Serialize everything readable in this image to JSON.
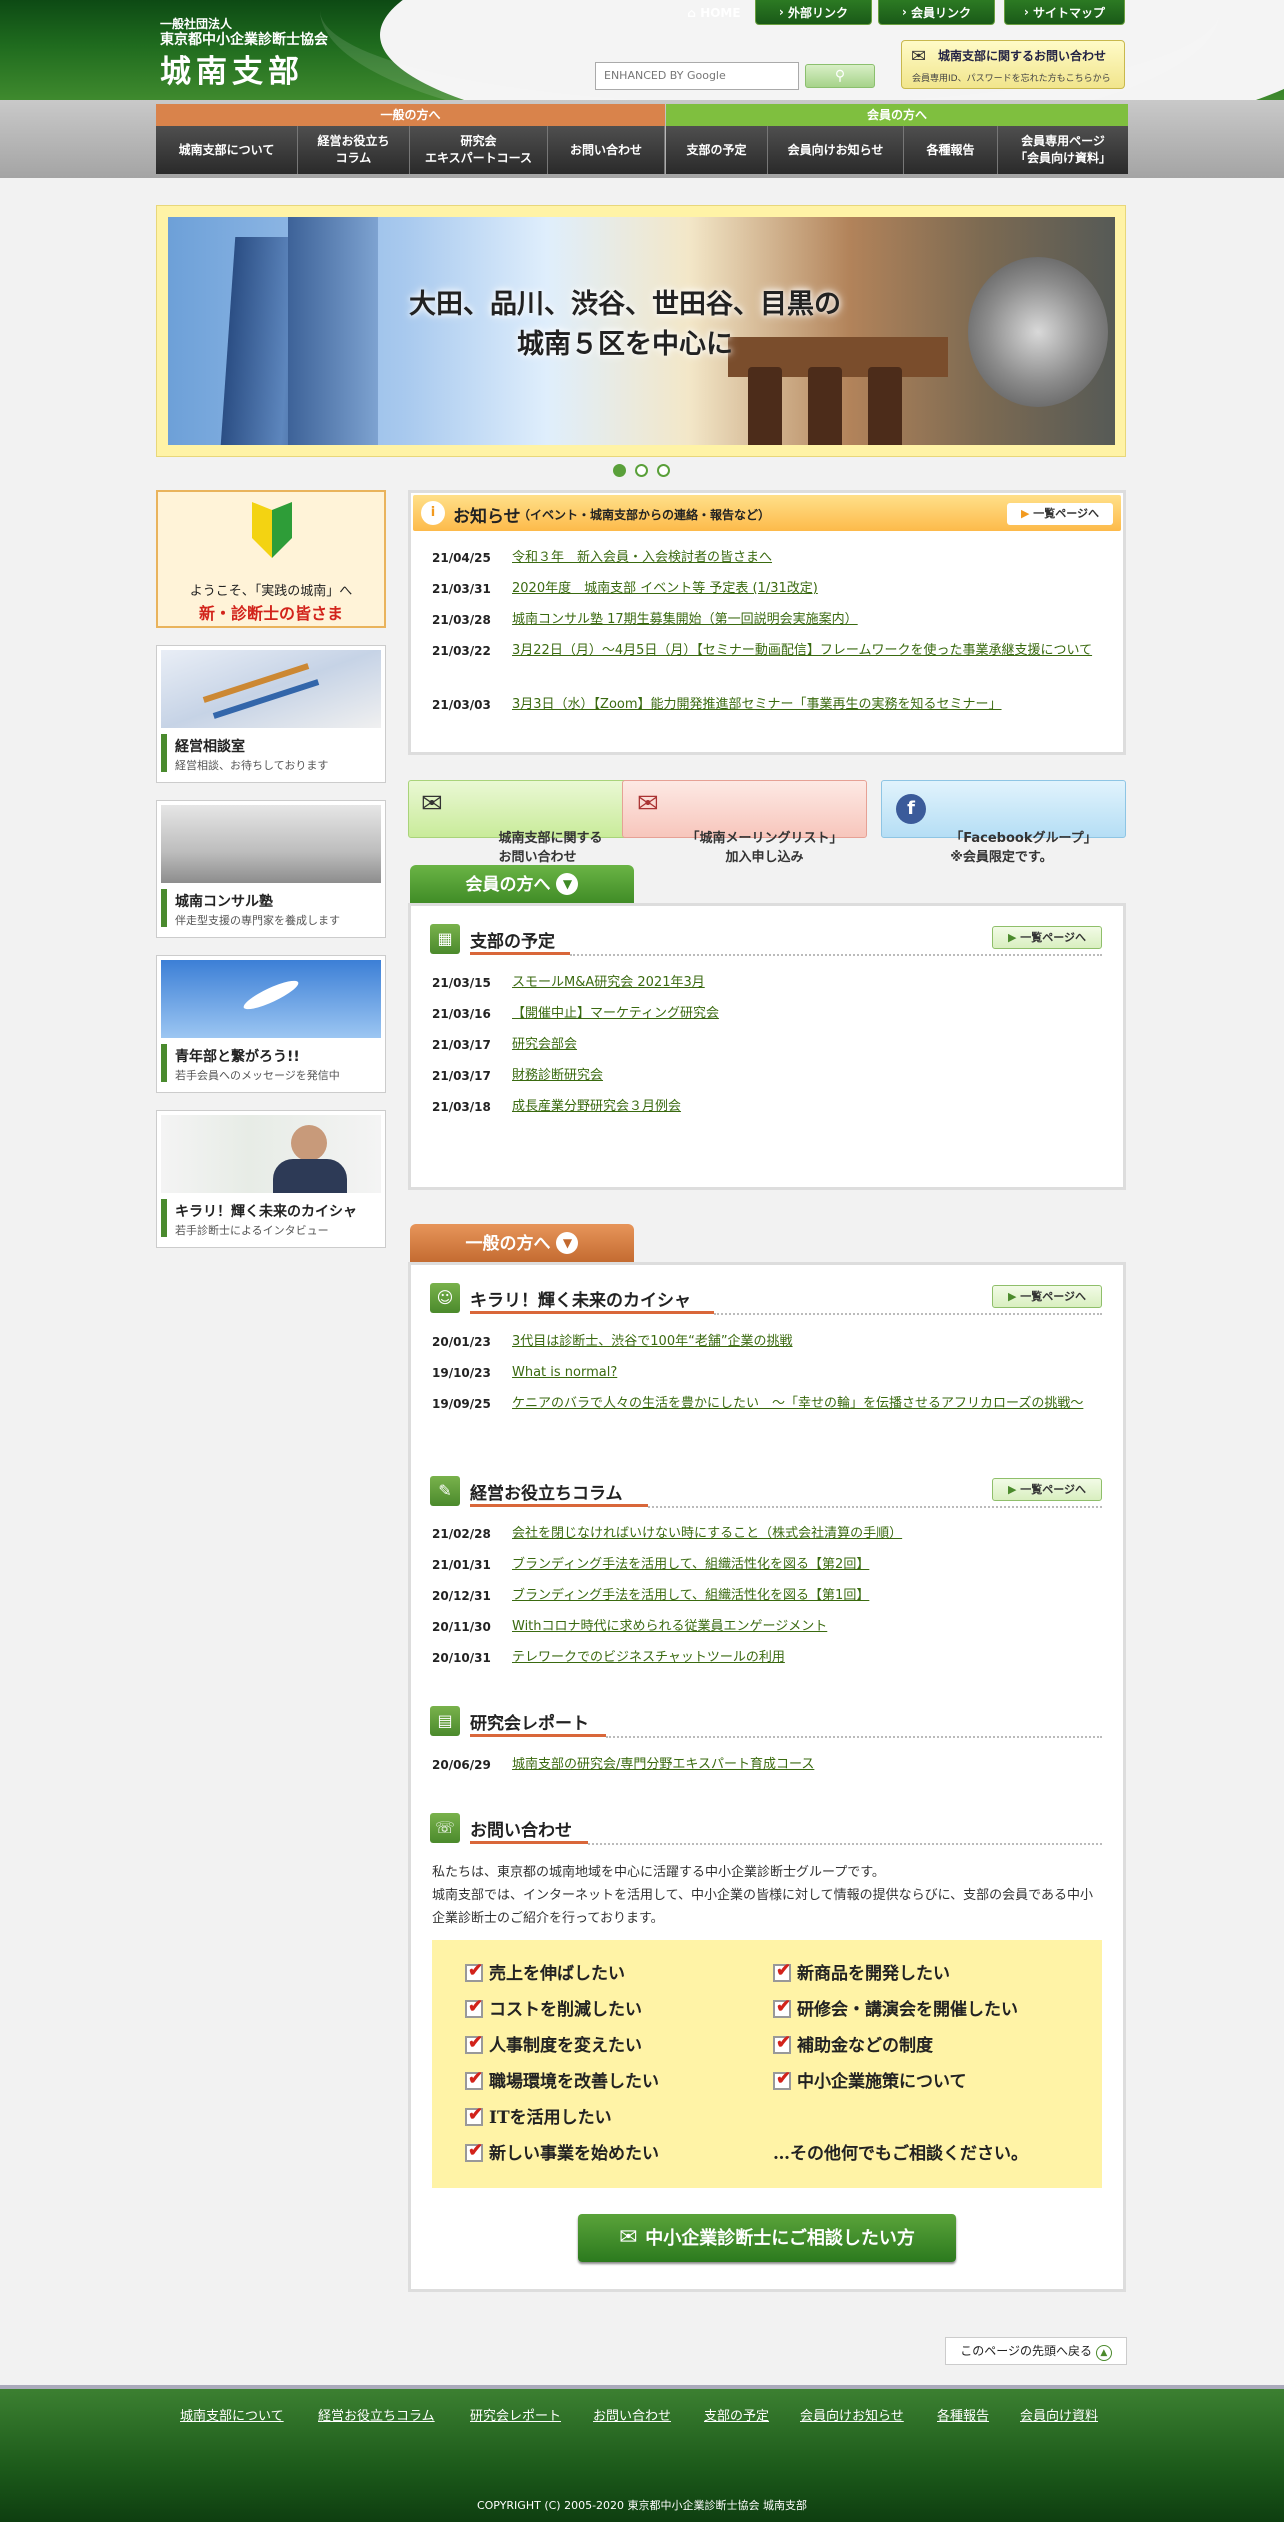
{
  "header": {
    "org_small": "一般社団法人",
    "org_name": "東京都中小企業診断士協会",
    "branch": "城南支部",
    "top_nav": [
      "HOME",
      "外部リンク",
      "会員リンク",
      "サイトマップ"
    ],
    "search_placeholder": "ENHANCED BY Google",
    "contact_title": "城南支部に関するお問い合わせ",
    "contact_sub": "会員専用ID、パスワードを忘れた方もこちらから"
  },
  "global_nav": {
    "general_label": "一般の方へ",
    "member_label": "会員の方へ",
    "items": [
      "城南支部について",
      "経営お役立ち\nコラム",
      "研究会\nエキスパートコース",
      "お問い合わせ",
      "支部の予定",
      "会員向けお知らせ",
      "各種報告",
      "会員専用ページ\n「会員向け資料」"
    ]
  },
  "hero": {
    "line1": "大田、品川、渋谷、世田谷、目黒の",
    "line2": "城南５区を中心に"
  },
  "sidebar": {
    "welcome1": "ようこそ、「実践の城南」へ",
    "welcome2": "新・診断士の皆さま",
    "items": [
      {
        "title": "経営相談室",
        "sub": "経営相談、お待ちしております"
      },
      {
        "title": "城南コンサル塾",
        "sub": "伴走型支援の専門家を養成します"
      },
      {
        "title": "青年部と繋がろう!!",
        "sub": "若手会員へのメッセージを発信中"
      },
      {
        "title": "キラリ！輝く未来のカイシャ",
        "sub": "若手診断士によるインタビュー"
      }
    ]
  },
  "notice": {
    "title": "お知らせ",
    "subtitle": "（イベント・城南支部からの連絡・報告など）",
    "list_button": "一覧ページへ",
    "items": [
      {
        "date": "21/04/25",
        "text": "令和３年　新入会員・入会検討者の皆さまへ"
      },
      {
        "date": "21/03/31",
        "text": "2020年度　城南支部 イベント等 予定表 (1/31改定)"
      },
      {
        "date": "21/03/28",
        "text": "城南コンサル塾 17期生募集開始（第一回説明会実施案内）"
      },
      {
        "date": "21/03/22",
        "text": "3月22日（月）～4月5日（月）【セミナー動画配信】フレームワークを使った事業承継支援について"
      },
      {
        "date": "21/03/03",
        "text": "3月3日（水）【Zoom】能力開発推進部セミナー「事業再生の実務を知るセミナー」"
      }
    ]
  },
  "cta_row": [
    {
      "text": "城南支部に関する\nお問い合わせ"
    },
    {
      "text": "「城南メーリングリスト」\n加入申し込み"
    },
    {
      "text": "「Facebookグループ」\n※会員限定です。"
    }
  ],
  "member_section": {
    "tab": "会員の方へ",
    "schedule_title": "支部の予定",
    "list_button": "一覧ページへ",
    "items": [
      {
        "date": "21/03/15",
        "text": "スモールM&A研究会 2021年3月"
      },
      {
        "date": "21/03/16",
        "text": "【開催中止】マーケティング研究会"
      },
      {
        "date": "21/03/17",
        "text": "研究会部会"
      },
      {
        "date": "21/03/17",
        "text": "財務診断研究会"
      },
      {
        "date": "21/03/18",
        "text": "成長産業分野研究会３月例会"
      }
    ]
  },
  "general_section": {
    "tab": "一般の方へ",
    "kirari": {
      "title": "キラリ！輝く未来のカイシャ",
      "list_button": "一覧ページへ",
      "items": [
        {
          "date": "20/01/23",
          "text": "3代目は診断士、渋谷で100年“老舗”企業の挑戦"
        },
        {
          "date": "19/10/23",
          "text": "What is normal?"
        },
        {
          "date": "19/09/25",
          "text": "ケニアのバラで人々の生活を豊かにしたい　～「幸せの輪」を伝播させるアフリカローズの挑戦～"
        }
      ]
    },
    "column": {
      "title": "経営お役立ちコラム",
      "list_button": "一覧ページへ",
      "items": [
        {
          "date": "21/02/28",
          "text": "会社を閉じなければいけない時にすること（株式会社清算の手順）"
        },
        {
          "date": "21/01/31",
          "text": "ブランディング手法を活用して、組織活性化を図る【第2回】"
        },
        {
          "date": "20/12/31",
          "text": "ブランディング手法を活用して、組織活性化を図る【第1回】"
        },
        {
          "date": "20/11/30",
          "text": "Withコロナ時代に求められる従業員エンゲージメント"
        },
        {
          "date": "20/10/31",
          "text": "テレワークでのビジネスチャットツールの利用"
        }
      ]
    },
    "report": {
      "title": "研究会レポート",
      "items": [
        {
          "date": "20/06/29",
          "text": "城南支部の研究会/専門分野エキスパート育成コース"
        }
      ]
    },
    "contact": {
      "title": "お問い合わせ",
      "p1": "私たちは、東京都の城南地域を中心に活躍する中小企業診断士グループです。",
      "p2": "城南支部では、インターネットを活用して、中小企業の皆様に対して情報の提供ならびに、支部の会員である中小企業診断士のご紹介を行っております。",
      "checks_left": [
        "売上を伸ばしたい",
        "コストを削減したい",
        "人事制度を変えたい",
        "職場環境を改善したい",
        "ITを活用したい",
        "新しい事業を始めたい"
      ],
      "checks_right": [
        "新商品を開発したい",
        "研修会・講演会を開催したい",
        "補助金などの制度",
        "中小企業施策について"
      ],
      "other": "…その他何でもご相談ください。",
      "button": "中小企業診断士にご相談したい方"
    }
  },
  "back_to_top": "このページの先頭へ戻る",
  "footer": {
    "links": [
      "城南支部について",
      "経営お役立ちコラム",
      "研究会レポート",
      "お問い合わせ",
      "支部の予定",
      "会員向けお知らせ",
      "各種報告",
      "会員向け資料"
    ],
    "copyright": "COPYRIGHT (C) 2005-2020 東京都中小企業診断士協会 城南支部"
  },
  "colors": {
    "brand_green": "#2c7a1e",
    "general_orange": "#d9834b",
    "member_green": "#7fbf3f",
    "accent_red": "#d9673a"
  }
}
